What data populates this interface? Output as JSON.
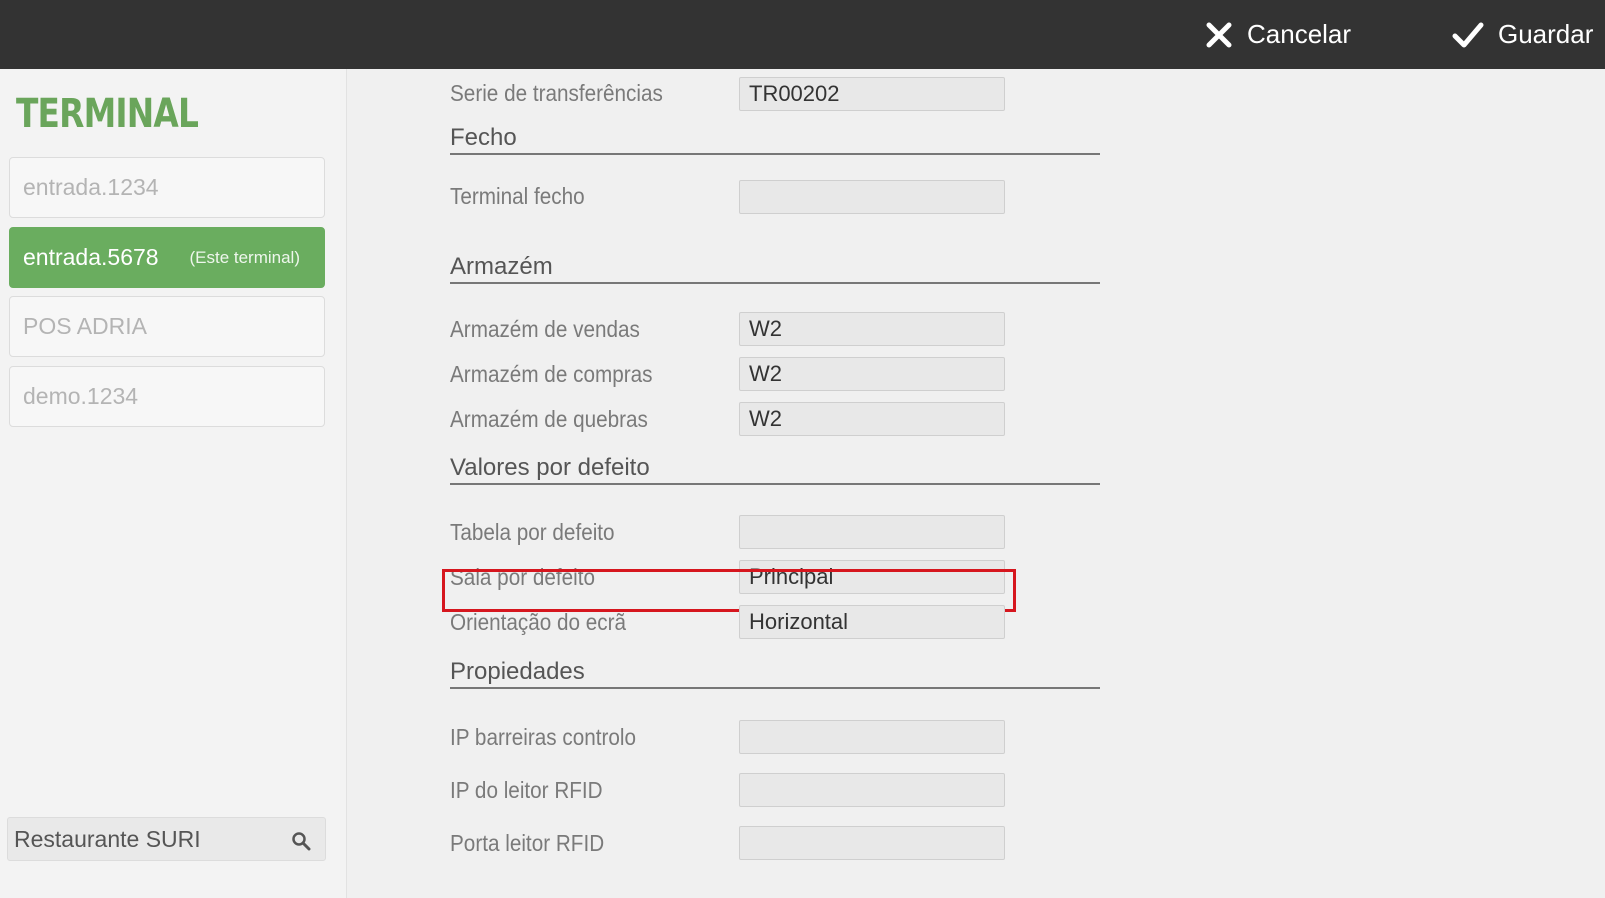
{
  "topbar": {
    "cancel_label": "Cancelar",
    "save_label": "Guardar"
  },
  "sidebar": {
    "title": "TERMINAL",
    "terminals": [
      {
        "label": "entrada.1234"
      },
      {
        "label": "entrada.5678",
        "note": "(Este terminal)"
      },
      {
        "label": "POS ADRIA"
      },
      {
        "label": "demo.1234"
      }
    ],
    "search_value": "Restaurante SURI"
  },
  "form": {
    "transfer_series": {
      "label": "Serie de transferências",
      "value": "TR00202"
    },
    "closing_section": "Fecho",
    "closing_terminal": {
      "label": "Terminal fecho",
      "value": ""
    },
    "warehouse_section": "Armazém",
    "sales_warehouse": {
      "label": "Armazém de vendas",
      "value": "W2"
    },
    "purchase_warehouse": {
      "label": "Armazém de compras",
      "value": "W2"
    },
    "breakage_warehouse": {
      "label": "Armazém de quebras",
      "value": "W2"
    },
    "defaults_section": "Valores por defeito",
    "default_table": {
      "label": "Tabela por defeito",
      "value": ""
    },
    "default_room": {
      "label": "Sala por defeito",
      "value": "Principal"
    },
    "screen_orientation": {
      "label": "Orientação do ecrã",
      "value": "Horizontal"
    },
    "properties_section": "Propiedades",
    "barrier_ip": {
      "label": "IP barreiras controlo",
      "value": ""
    },
    "rfid_ip": {
      "label": "IP do leitor RFID",
      "value": ""
    },
    "rfid_port": {
      "label": "Porta leitor RFID",
      "value": ""
    }
  },
  "colors": {
    "accent": "#6aad5f",
    "topbar": "#333333",
    "highlight": "#d6161e"
  }
}
